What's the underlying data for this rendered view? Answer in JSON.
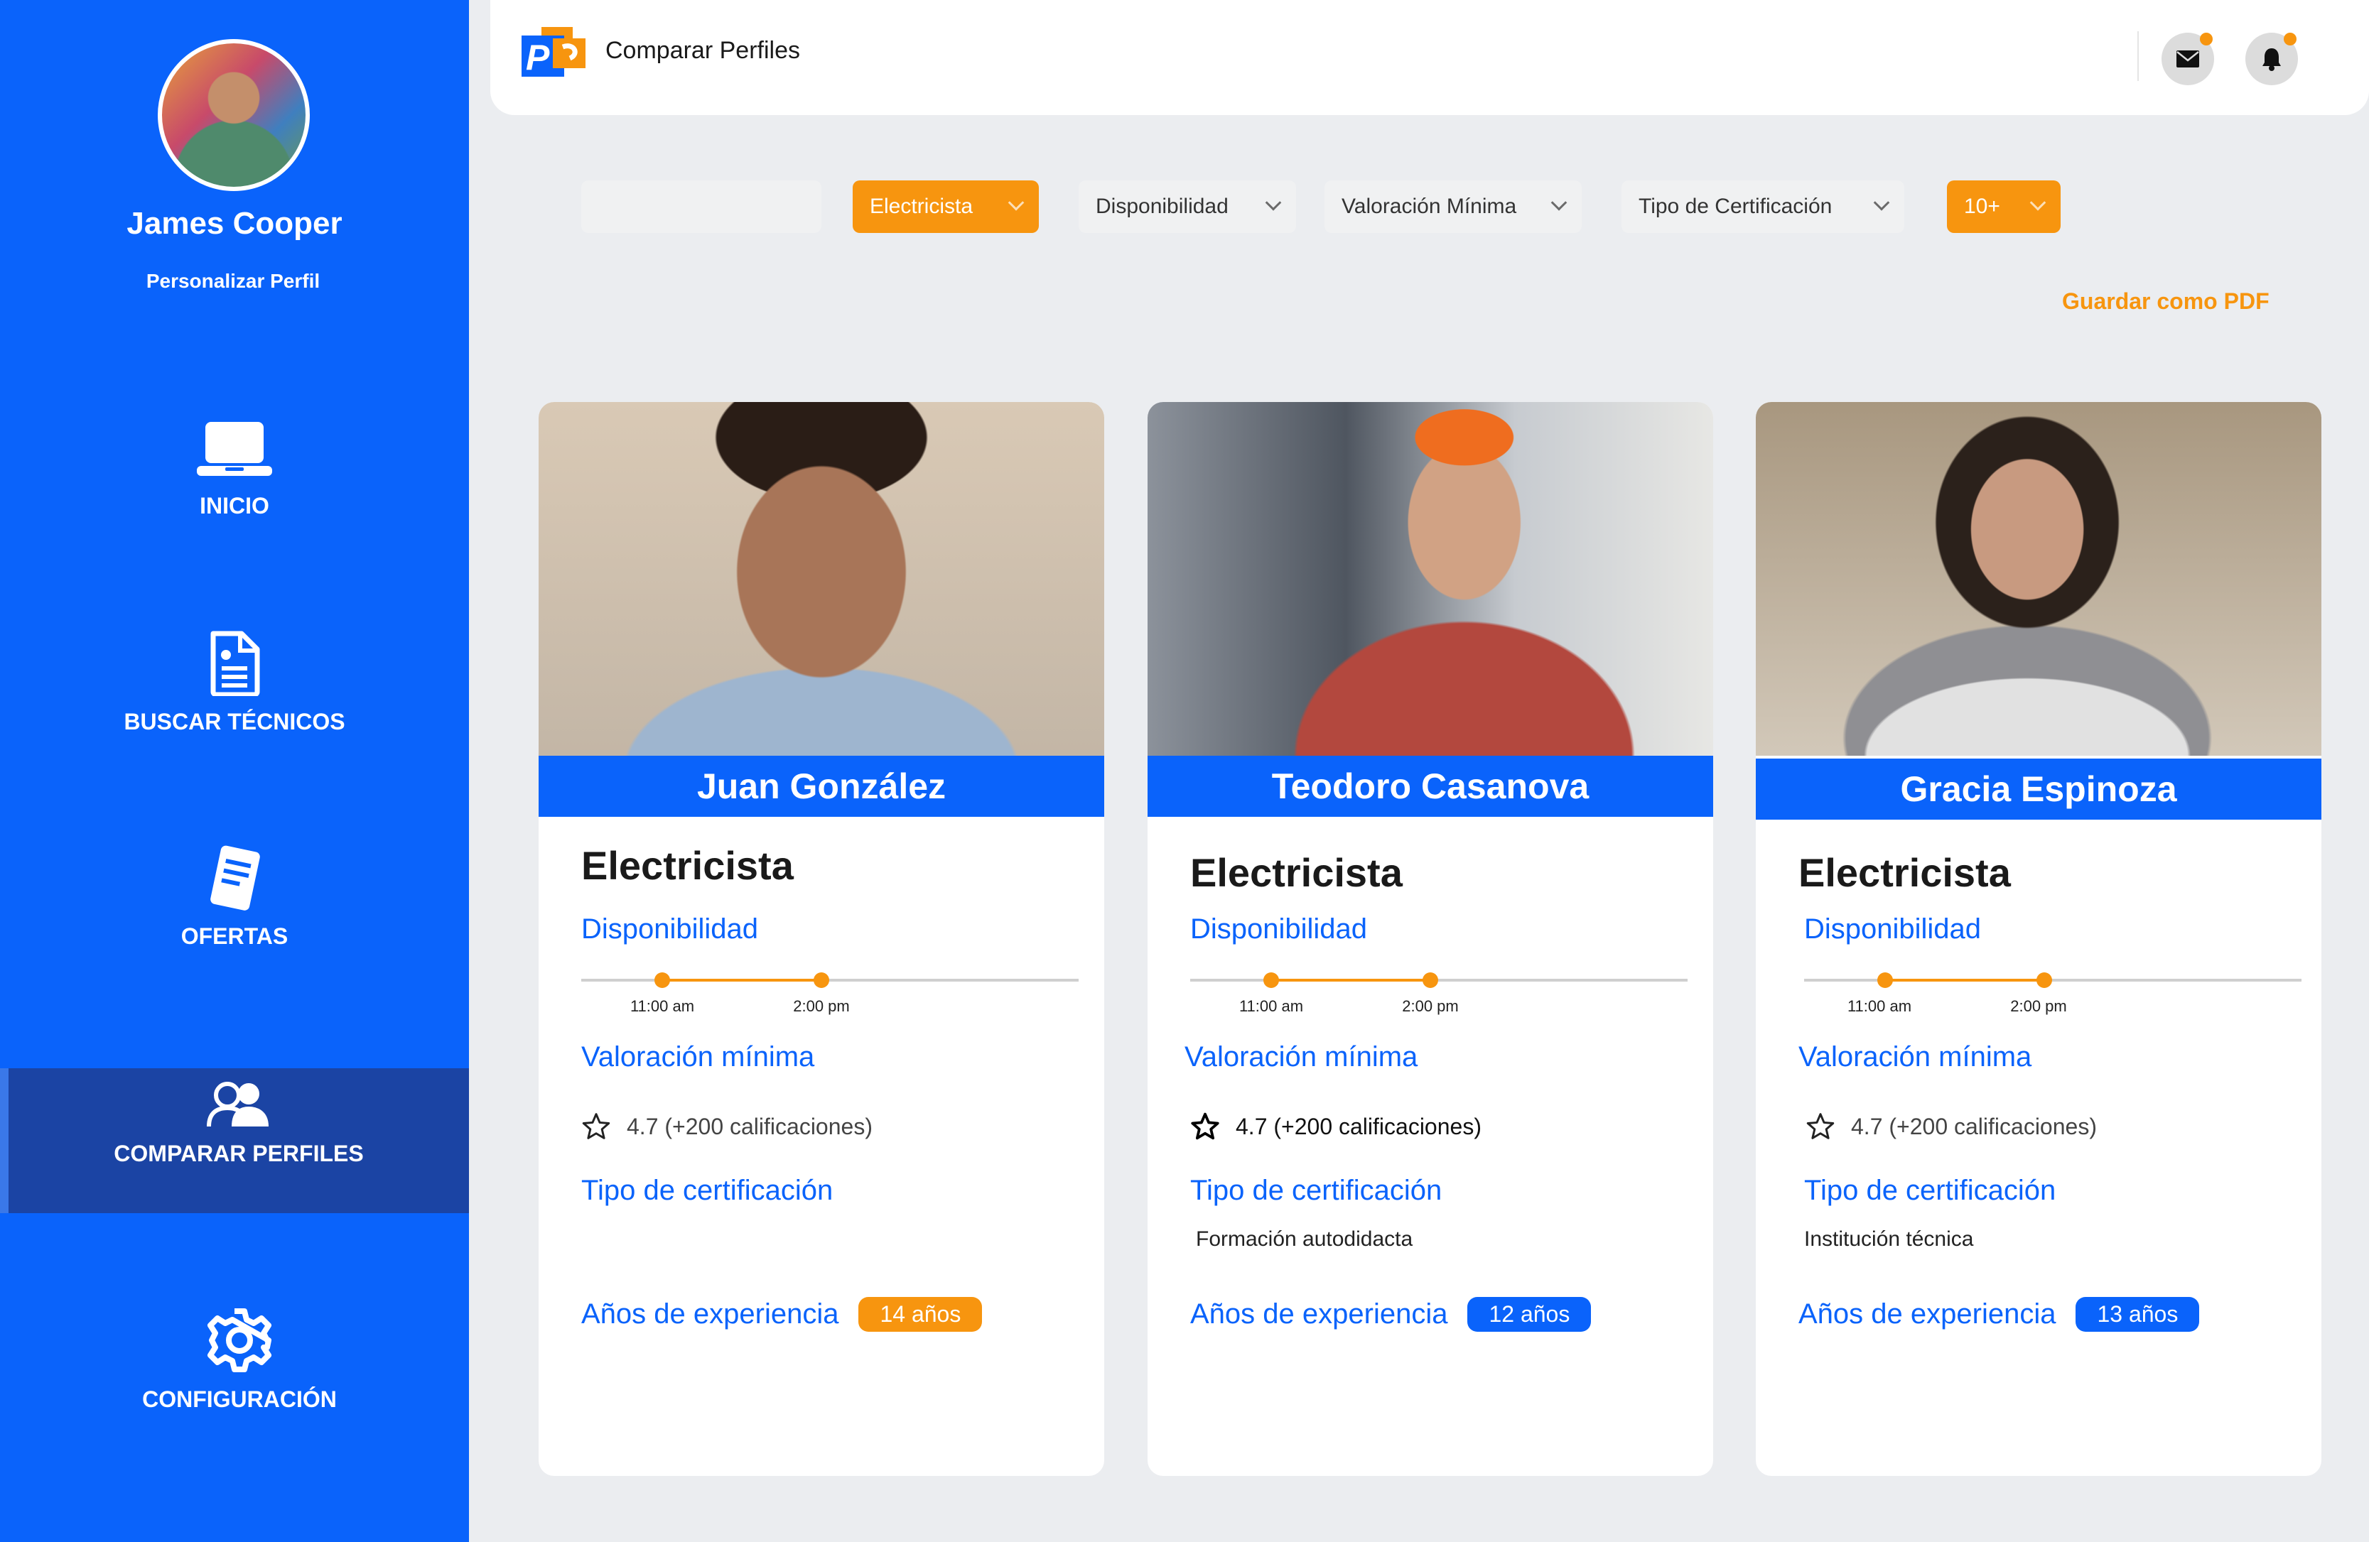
{
  "sidebar": {
    "user_name": "James Cooper",
    "customize_label": "Personalizar Perfil",
    "nav": [
      {
        "label": "INICIO",
        "icon": "laptop-icon"
      },
      {
        "label": "BUSCAR TÉCNICOS",
        "icon": "document-search-icon"
      },
      {
        "label": "OFERTAS",
        "icon": "offers-icon"
      },
      {
        "label": "COMPARAR PERFILES",
        "icon": "users-icon",
        "active": true
      },
      {
        "label": "CONFIGURACIÓN",
        "icon": "gear-icon"
      }
    ]
  },
  "header": {
    "title": "Comparar Perfiles",
    "icons": [
      "mail-icon",
      "bell-icon"
    ]
  },
  "filters": {
    "search_value": "",
    "specialty": "Electricista",
    "availability": "Disponibilidad",
    "min_rating": "Valoración Mínima",
    "cert_type": "Tipo de Certificación",
    "experience": "10+"
  },
  "actions": {
    "save_pdf": "Guardar como PDF"
  },
  "labels": {
    "availability": "Disponibilidad",
    "min_rating": "Valoración mínima",
    "cert_type": "Tipo de certificación",
    "experience": "Años de experiencia"
  },
  "profiles": [
    {
      "name": "Juan González",
      "role": "Electricista",
      "time_start": "11:00 am",
      "time_end": "2:00 pm",
      "rating_text": "4.7 (+200 calificaciones)",
      "certification": "",
      "experience": "14 años",
      "experience_color": "#f7950f"
    },
    {
      "name": "Teodoro Casanova",
      "role": "Electricista",
      "time_start": "11:00 am",
      "time_end": "2:00 pm",
      "rating_text": "4.7 (+200 calificaciones)",
      "certification": "Formación autodidacta",
      "experience": "12 años",
      "experience_color": "#0a63fb"
    },
    {
      "name": "Gracia Espinoza",
      "role": "Electricista",
      "time_start": "11:00 am",
      "time_end": "2:00 pm",
      "rating_text": "4.7 (+200 calificaciones)",
      "certification": "Institución técnica",
      "experience": "13 años",
      "experience_color": "#0a63fb"
    }
  ],
  "colors": {
    "primary": "#0a63fb",
    "accent": "#f7950f",
    "active_nav": "#1b44a4"
  }
}
